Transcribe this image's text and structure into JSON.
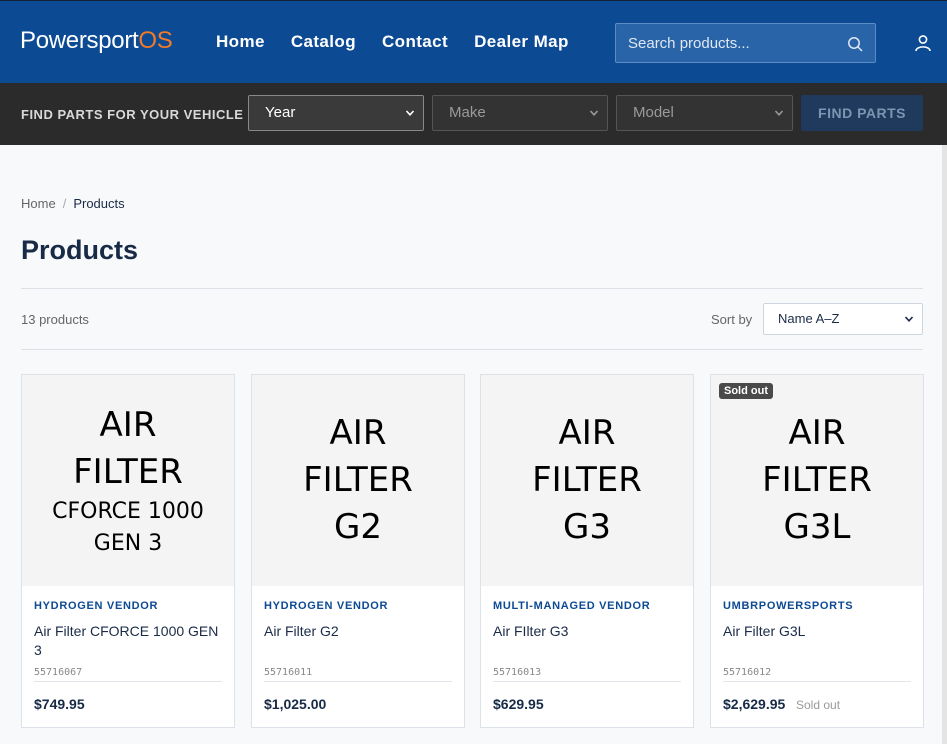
{
  "header": {
    "logo_main": "Powersport",
    "logo_accent": "OS",
    "nav": [
      "Home",
      "Catalog",
      "Contact",
      "Dealer Map"
    ],
    "search_placeholder": "Search products..."
  },
  "vehicle_finder": {
    "label": "FIND PARTS FOR YOUR VEHICLE",
    "year": "Year",
    "make": "Make",
    "model": "Model",
    "button": "FIND PARTS"
  },
  "breadcrumb": {
    "home": "Home",
    "separator": "/",
    "current": "Products"
  },
  "page_title": "Products",
  "toolbar": {
    "count": "13 products",
    "sort_label": "Sort by",
    "sort_value": "Name A–Z"
  },
  "products": [
    {
      "img_lines": [
        "AIR",
        "FILTER",
        "CFORCE 1000",
        "GEN 3"
      ],
      "vendor": "HYDROGEN VENDOR",
      "name": "Air Filter CFORCE 1000 GEN 3",
      "sku": "55716067",
      "price": "$749.95",
      "badge": "",
      "sold_text": ""
    },
    {
      "img_lines": [
        "AIR",
        "FILTER",
        "G2"
      ],
      "vendor": "HYDROGEN VENDOR",
      "name": "Air Filter G2",
      "sku": "55716011",
      "price": "$1,025.00",
      "badge": "",
      "sold_text": ""
    },
    {
      "img_lines": [
        "AIR",
        "FILTER",
        "G3"
      ],
      "vendor": "MULTI-MANAGED VENDOR",
      "name": "Air FIlter G3",
      "sku": "55716013",
      "price": "$629.95",
      "badge": "",
      "sold_text": ""
    },
    {
      "img_lines": [
        "AIR",
        "FILTER",
        "G3L"
      ],
      "vendor": "UMBRPOWERSPORTS",
      "name": "Air Filter G3L",
      "sku": "55716012",
      "price": "$2,629.95",
      "badge": "Sold out",
      "sold_text": "Sold out"
    }
  ],
  "colors": {
    "header_bg": "#0c4a93",
    "logo_accent": "#f07a2a",
    "vehicle_bar": "#2b2b2b",
    "vendor_text": "#0c4a93"
  },
  "icons": {
    "search": "search-icon",
    "user": "user-icon",
    "chevron": "chevron-down-icon"
  }
}
